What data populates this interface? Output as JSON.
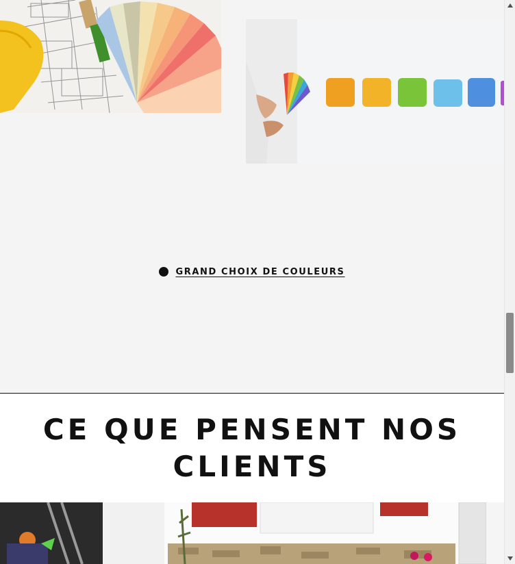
{
  "feature": {
    "label": "GRAND CHOIX DE COULEURS"
  },
  "testimonials": {
    "title": "CE QUE PENSENT NOS CLIENTS"
  },
  "colors": {
    "background": "#f4f4f4",
    "text": "#111111",
    "section_bg": "#ffffff"
  }
}
